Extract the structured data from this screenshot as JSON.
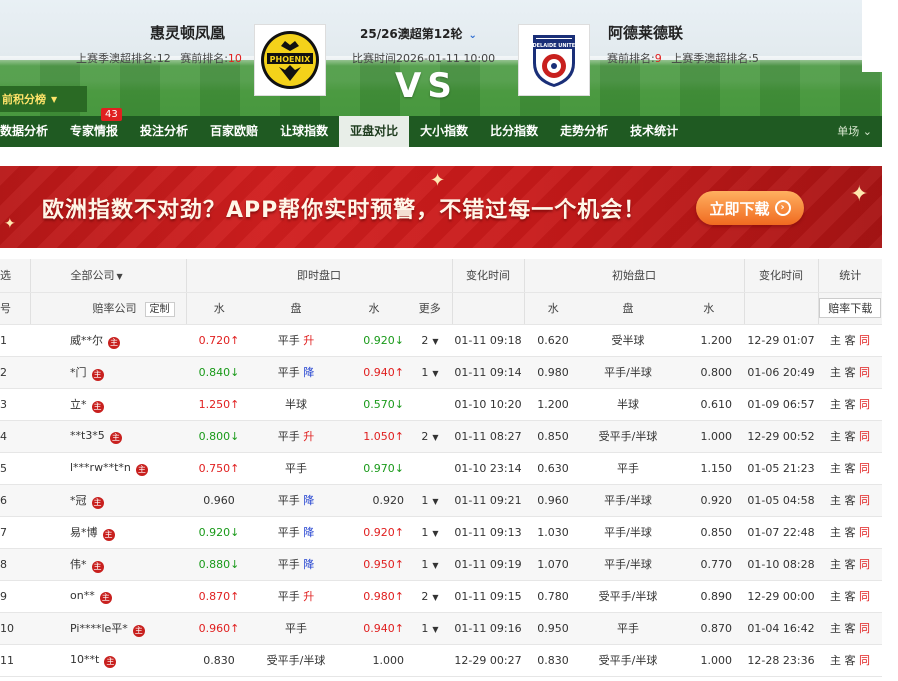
{
  "header": {
    "home_team": "惠灵顿凤凰",
    "home_last_label": "上赛季澳超排名:12",
    "home_pre_label": "赛前排名:",
    "home_pre_value": "10",
    "match_round": "25/26澳超第12轮",
    "match_time": "比赛时间2026-01-11 10:00",
    "vs": "VS",
    "away_team": "阿德莱德联",
    "away_pre_label": "赛前排名:",
    "away_pre_value": "9",
    "away_last_label": "上赛季澳超排名:5",
    "rank_button": "前积分榜",
    "home_logo_text": "PHOENIX",
    "away_logo_text": "ADELAIDE UNITED"
  },
  "nav": {
    "items": [
      "数据分析",
      "专家情报",
      "投注分析",
      "百家欧赔",
      "让球指数",
      "亚盘对比",
      "大小指数",
      "比分指数",
      "走势分析",
      "技术统计"
    ],
    "badge": "43",
    "right": "单场"
  },
  "banner": {
    "text": "欧洲指数不对劲？APP帮你实时预警，不错过每一个机会！",
    "button": "立即下载"
  },
  "table": {
    "head1": {
      "sel": "选",
      "all_companies": "全部公司",
      "live": "即时盘口",
      "change_time": "变化时间",
      "initial": "初始盘口",
      "change_time2": "变化时间",
      "stats": "统计"
    },
    "head2": {
      "no": "号",
      "company": "赔率公司",
      "custom": "定制",
      "water": "水",
      "handicap": "盘",
      "water2": "水",
      "more": "更多",
      "init_water": "水",
      "init_handicap": "盘",
      "init_water2": "水",
      "download": "赔率下载"
    },
    "rows": [
      {
        "no": "1",
        "company": "威**尔",
        "w1": "0.720↑",
        "w1c": "up",
        "hc": "平手",
        "dir": "升",
        "w2": "0.920↓",
        "w2c": "down",
        "more": "2",
        "time": "01-11 09:18",
        "iw1": "0.620",
        "ihc": "受半球",
        "iw2": "1.200",
        "itime": "12-29 01:07"
      },
      {
        "no": "2",
        "company": "*门",
        "w1": "0.840↓",
        "w1c": "down",
        "hc": "平手",
        "dir": "降",
        "w2": "0.940↑",
        "w2c": "up",
        "more": "1",
        "time": "01-11 09:14",
        "iw1": "0.980",
        "ihc": "平手/半球",
        "iw2": "0.800",
        "itime": "01-06 20:49"
      },
      {
        "no": "3",
        "company": "立*",
        "w1": "1.250↑",
        "w1c": "up",
        "hc": "半球",
        "dir": "",
        "w2": "0.570↓",
        "w2c": "down",
        "more": "",
        "time": "01-10 10:20",
        "iw1": "1.200",
        "ihc": "半球",
        "iw2": "0.610",
        "itime": "01-09 06:57"
      },
      {
        "no": "4",
        "company": "**t3*5",
        "w1": "0.800↓",
        "w1c": "down",
        "hc": "平手",
        "dir": "升",
        "w2": "1.050↑",
        "w2c": "up",
        "more": "2",
        "time": "01-11 08:27",
        "iw1": "0.850",
        "ihc": "受平手/半球",
        "iw2": "1.000",
        "itime": "12-29 00:52"
      },
      {
        "no": "5",
        "company": "l***rw**t*n",
        "w1": "0.750↑",
        "w1c": "up",
        "hc": "平手",
        "dir": "",
        "w2": "0.970↓",
        "w2c": "down",
        "more": "",
        "time": "01-10 23:14",
        "iw1": "0.630",
        "ihc": "平手",
        "iw2": "1.150",
        "itime": "01-05 21:23"
      },
      {
        "no": "6",
        "company": "*冠",
        "w1": "0.960",
        "w1c": "",
        "hc": "平手",
        "dir": "降",
        "w2": "0.920",
        "w2c": "",
        "more": "1",
        "time": "01-11 09:21",
        "iw1": "0.960",
        "ihc": "平手/半球",
        "iw2": "0.920",
        "itime": "01-05 04:58"
      },
      {
        "no": "7",
        "company": "易*博",
        "w1": "0.920↓",
        "w1c": "down",
        "hc": "平手",
        "dir": "降",
        "w2": "0.920↑",
        "w2c": "up",
        "more": "1",
        "time": "01-11 09:13",
        "iw1": "1.030",
        "ihc": "平手/半球",
        "iw2": "0.850",
        "itime": "01-07 22:48"
      },
      {
        "no": "8",
        "company": "伟*",
        "w1": "0.880↓",
        "w1c": "down",
        "hc": "平手",
        "dir": "降",
        "w2": "0.950↑",
        "w2c": "up",
        "more": "1",
        "time": "01-11 09:19",
        "iw1": "1.070",
        "ihc": "平手/半球",
        "iw2": "0.770",
        "itime": "01-10 08:28"
      },
      {
        "no": "9",
        "company": "on**",
        "w1": "0.870↑",
        "w1c": "up",
        "hc": "平手",
        "dir": "升",
        "w2": "0.980↑",
        "w2c": "up",
        "more": "2",
        "time": "01-11 09:15",
        "iw1": "0.780",
        "ihc": "受平手/半球",
        "iw2": "0.890",
        "itime": "12-29 00:00"
      },
      {
        "no": "10",
        "company": "Pi****le平*",
        "w1": "0.960↑",
        "w1c": "up",
        "hc": "平手",
        "dir": "",
        "w2": "0.940↑",
        "w2c": "up",
        "more": "1",
        "time": "01-11 09:16",
        "iw1": "0.950",
        "ihc": "平手",
        "iw2": "0.870",
        "itime": "01-04 16:42"
      },
      {
        "no": "11",
        "company": "10**t",
        "w1": "0.830",
        "w1c": "",
        "hc": "受平手/半球",
        "dir": "",
        "w2": "1.000",
        "w2c": "",
        "more": "",
        "time": "12-29 00:27",
        "iw1": "0.830",
        "ihc": "受平手/半球",
        "iw2": "1.000",
        "itime": "12-28 23:36"
      }
    ],
    "links": {
      "home": "主",
      "guest": "客",
      "same": "同"
    },
    "zhu_icon": "主"
  }
}
